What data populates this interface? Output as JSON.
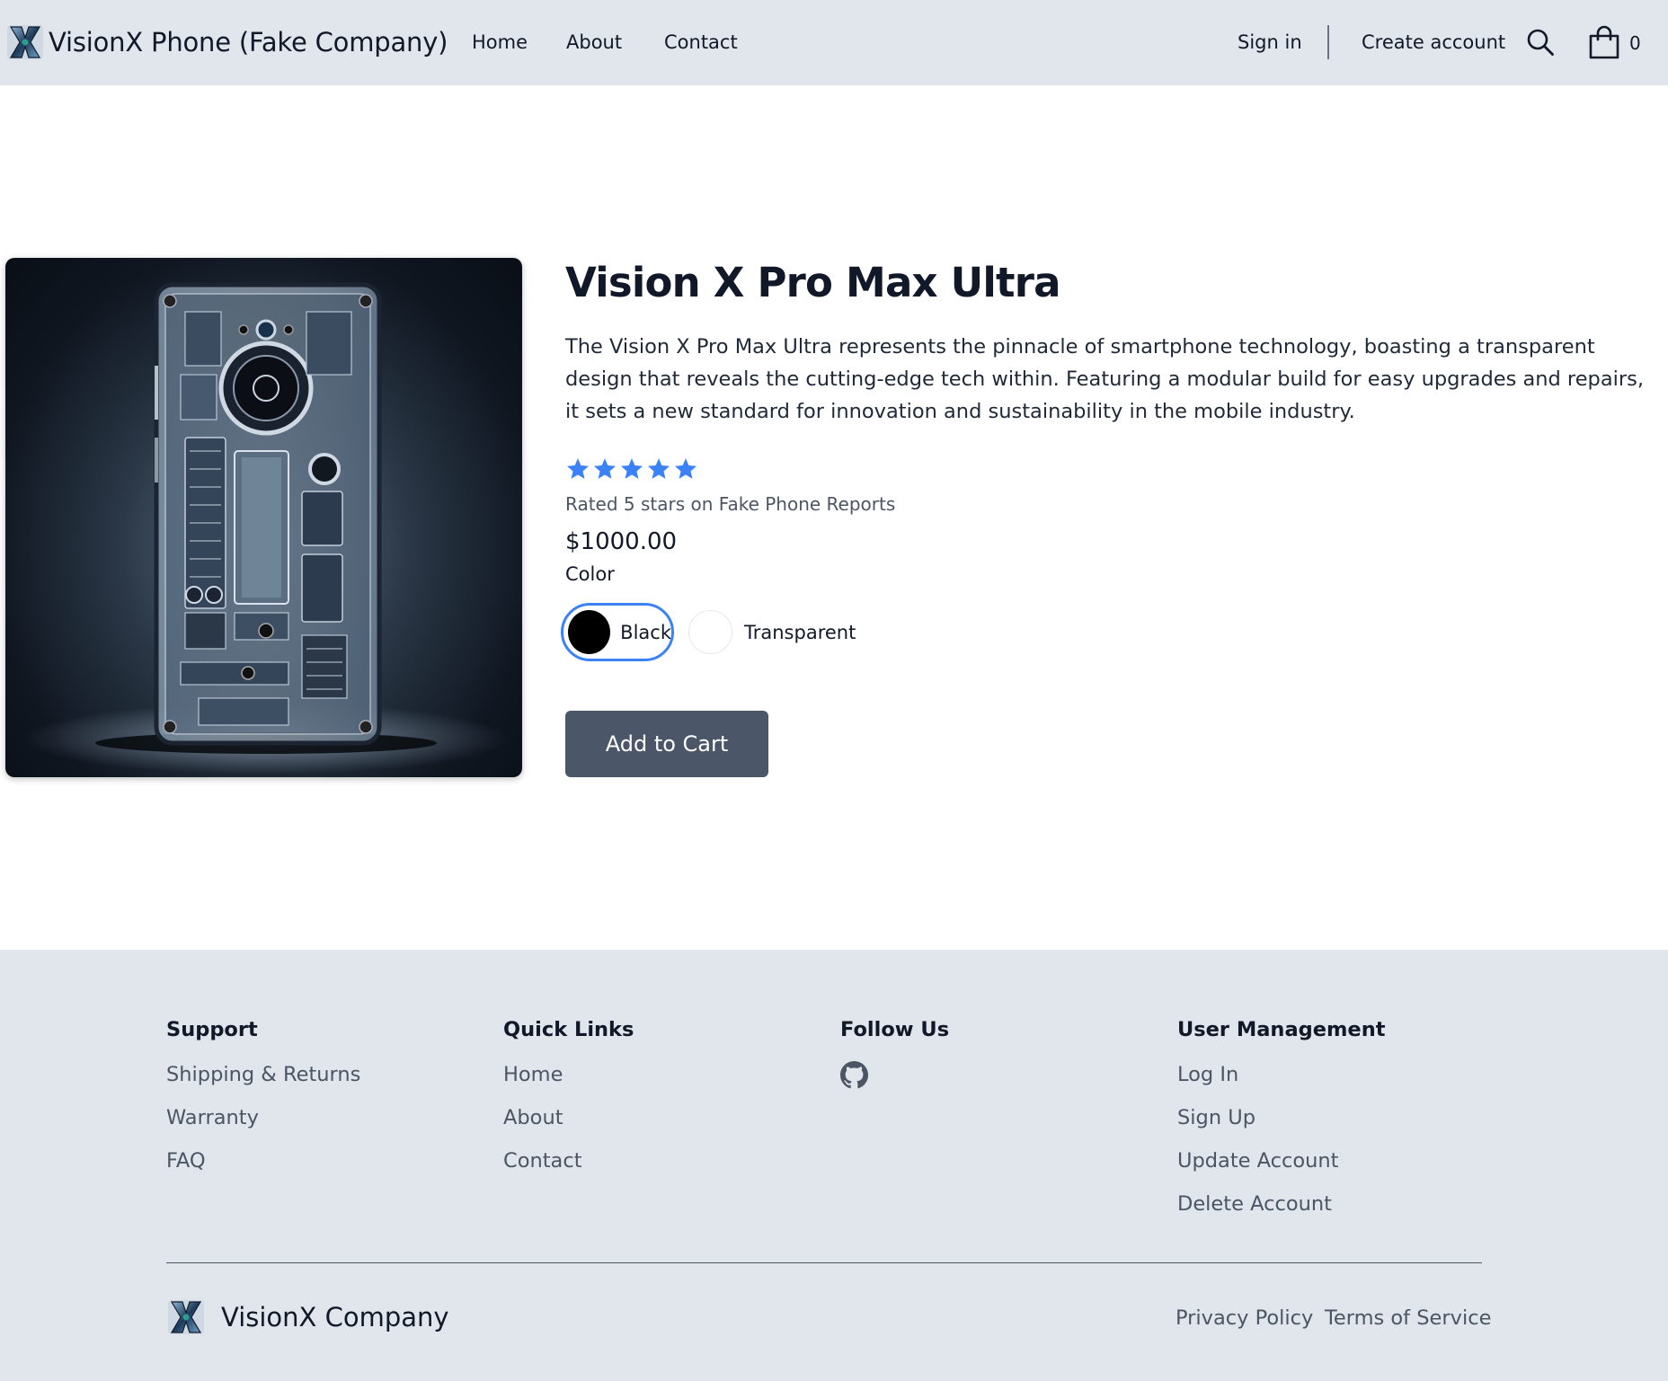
{
  "header": {
    "brand_name": "VisionX Phone (Fake Company)",
    "nav": {
      "home": "Home",
      "about": "About",
      "contact": "Contact"
    },
    "sign_in": "Sign in",
    "create_account": "Create account",
    "cart_count": "0"
  },
  "product": {
    "title": "Vision X Pro Max Ultra",
    "description": "The Vision X Pro Max Ultra represents the pinnacle of smartphone technology, boasting a transparent design that reveals the cutting-edge tech within. Featuring a modular build for easy upgrades and repairs, it sets a new standard for innovation and sustainability in the mobile industry.",
    "rating_stars": 5,
    "rating_max": 5,
    "rating_text": "Rated 5 stars on Fake Phone Reports",
    "price": "$1000.00",
    "color_label": "Color",
    "colors": [
      {
        "name": "Black",
        "selected": true
      },
      {
        "name": "Transparent",
        "selected": false
      }
    ],
    "add_to_cart": "Add to Cart",
    "accent_color": "#3b82f6",
    "button_color": "#4b5669"
  },
  "footer": {
    "support": {
      "heading": "Support",
      "links": [
        "Shipping & Returns",
        "Warranty",
        "FAQ"
      ]
    },
    "quick_links": {
      "heading": "Quick Links",
      "links": [
        "Home",
        "About",
        "Contact"
      ]
    },
    "follow_us": {
      "heading": "Follow Us",
      "icon": "github-icon"
    },
    "user_management": {
      "heading": "User Management",
      "links": [
        "Log In",
        "Sign Up",
        "Update Account",
        "Delete Account"
      ]
    },
    "brand_name": "VisionX Company",
    "privacy_policy": "Privacy Policy",
    "terms_of_service": "Terms of Service"
  }
}
